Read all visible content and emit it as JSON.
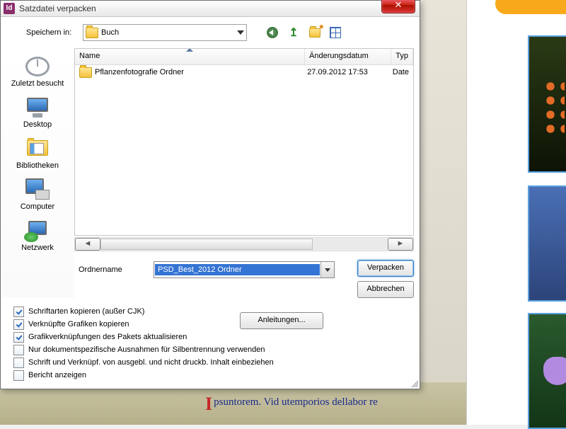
{
  "window": {
    "app_icon_text": "Id",
    "title": "Satzdatei verpacken",
    "close_glyph": "✕"
  },
  "toolbar": {
    "save_in_label": "Speichern in:",
    "current_folder": "Buch"
  },
  "places": {
    "recent": "Zuletzt besucht",
    "desktop": "Desktop",
    "libraries": "Bibliotheken",
    "computer": "Computer",
    "network": "Netzwerk"
  },
  "listview": {
    "columns": {
      "name": "Name",
      "date": "Änderungsdatum",
      "type": "Typ"
    },
    "rows": [
      {
        "name": "Pflanzenfotografie Ordner",
        "date": "27.09.2012 17:53",
        "type": "Date"
      }
    ]
  },
  "filename": {
    "label": "Ordnername",
    "value": "PSD_Best_2012 Ordner"
  },
  "buttons": {
    "primary": "Verpacken",
    "cancel": "Abbrechen",
    "instructions": "Anleitungen..."
  },
  "checkboxes": {
    "copy_fonts": "Schriftarten kopieren (außer CJK)",
    "copy_graphics": "Verknüpfte Grafiken kopieren",
    "update_links": "Grafikverknüpfungen des Pakets aktualisieren",
    "hyphenation": "Nur dokumentspezifische Ausnahmen für Silbentrennung verwenden",
    "hidden_content": "Schrift und Verknüpf. von ausgebl. und nicht druckb. Inhalt einbeziehen",
    "show_report": "Bericht anzeigen"
  },
  "background": {
    "body_text": "psuntorem. Vid utemporios dellabor re"
  }
}
